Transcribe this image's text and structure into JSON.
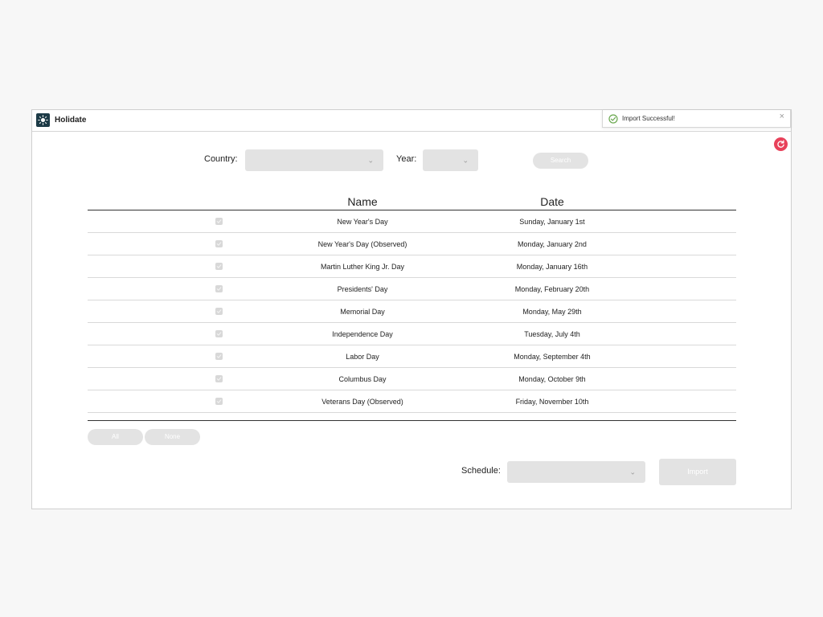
{
  "app": {
    "title": "Holidate",
    "logo_icon": "sun-icon",
    "brand_color": "#1d3b47"
  },
  "toast": {
    "message": "Import Successful!",
    "icon": "check-circle-icon",
    "close_label": "×"
  },
  "refresh": {
    "icon": "refresh-icon",
    "color": "#e8415a"
  },
  "filters": {
    "country_label": "Country:",
    "country_value": "",
    "year_label": "Year:",
    "year_value": "",
    "search_label": "Search"
  },
  "table": {
    "columns": [
      "Name",
      "Date"
    ],
    "rows": [
      {
        "name": "New Year's Day",
        "date": "Sunday, January 1st",
        "checked": true
      },
      {
        "name": "New Year's Day (Observed)",
        "date": "Monday, January 2nd",
        "checked": true
      },
      {
        "name": "Martin Luther King Jr. Day",
        "date": "Monday, January 16th",
        "checked": true
      },
      {
        "name": "Presidents' Day",
        "date": "Monday, February 20th",
        "checked": true
      },
      {
        "name": "Memorial Day",
        "date": "Monday, May 29th",
        "checked": true
      },
      {
        "name": "Independence Day",
        "date": "Tuesday, July 4th",
        "checked": true
      },
      {
        "name": "Labor Day",
        "date": "Monday, September 4th",
        "checked": true
      },
      {
        "name": "Columbus Day",
        "date": "Monday, October 9th",
        "checked": true
      },
      {
        "name": "Veterans Day (Observed)",
        "date": "Friday, November 10th",
        "checked": true
      }
    ]
  },
  "selection": {
    "all_label": "All",
    "none_label": "None"
  },
  "schedule": {
    "label": "Schedule:",
    "value": "",
    "import_label": "Import"
  }
}
